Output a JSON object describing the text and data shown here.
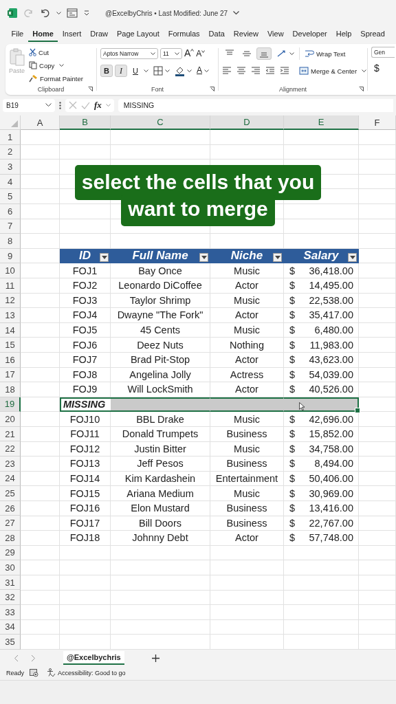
{
  "title_bar": {
    "title": "@ExcelbyChris • Last Modified: June 27"
  },
  "menu_tabs": [
    {
      "label": "File",
      "selected": false
    },
    {
      "label": "Home",
      "selected": true
    },
    {
      "label": "Insert",
      "selected": false
    },
    {
      "label": "Draw",
      "selected": false
    },
    {
      "label": "Page Layout",
      "selected": false
    },
    {
      "label": "Formulas",
      "selected": false
    },
    {
      "label": "Data",
      "selected": false
    },
    {
      "label": "Review",
      "selected": false
    },
    {
      "label": "View",
      "selected": false
    },
    {
      "label": "Developer",
      "selected": false
    },
    {
      "label": "Help",
      "selected": false
    },
    {
      "label": "Spread",
      "selected": false
    }
  ],
  "ribbon": {
    "clipboard": {
      "paste": "Paste",
      "paste_disabled": true,
      "cut": "Cut",
      "copy": "Copy",
      "format_painter": "Format Painter",
      "label": "Clipboard"
    },
    "font": {
      "font_name": "Aptos Narrow",
      "font_size": "11",
      "grow": "A",
      "shrink": "A",
      "bold": {
        "label": "B",
        "on": true
      },
      "italic": {
        "label": "I",
        "on": true
      },
      "underline": {
        "label": "U",
        "on": false
      },
      "font_color": "A",
      "label": "Font"
    },
    "alignment": {
      "vertical": [
        {
          "kind": "top",
          "selected": false
        },
        {
          "kind": "middle",
          "selected": false
        },
        {
          "kind": "bottom",
          "selected": true
        }
      ],
      "wrap_text": "Wrap Text",
      "merge": "Merge & Center",
      "label": "Alignment"
    },
    "number": {
      "format": "Gen",
      "currency": "$"
    }
  },
  "formula_bar": {
    "name_box": "B19",
    "function_label": "fx",
    "value": "MISSING"
  },
  "sheet": {
    "columns": [
      {
        "label": "A",
        "selected": false
      },
      {
        "label": "B",
        "selected": true
      },
      {
        "label": "C",
        "selected": true
      },
      {
        "label": "D",
        "selected": true
      },
      {
        "label": "E",
        "selected": true
      },
      {
        "label": "F",
        "selected": false
      }
    ],
    "header": [
      "ID",
      "Full Name",
      "Niche",
      "Salary"
    ],
    "rows": [
      {
        "number": "1",
        "kind": "empty",
        "selected": false
      },
      {
        "number": "2",
        "kind": "empty",
        "selected": false
      },
      {
        "number": "3",
        "kind": "empty",
        "selected": false
      },
      {
        "number": "4",
        "kind": "empty",
        "selected": false
      },
      {
        "number": "5",
        "kind": "empty",
        "selected": false
      },
      {
        "number": "6",
        "kind": "empty",
        "selected": false
      },
      {
        "number": "7",
        "kind": "empty",
        "selected": false
      },
      {
        "number": "8",
        "kind": "empty",
        "selected": false
      },
      {
        "number": "9",
        "kind": "header",
        "selected": false
      },
      {
        "number": "10",
        "kind": "data",
        "selected": false,
        "id": "FOJ1",
        "name": "Bay Once",
        "niche": "Music",
        "currency": "$",
        "salary": "36,418.00"
      },
      {
        "number": "11",
        "kind": "data",
        "selected": false,
        "id": "FOJ2",
        "name": "Leonardo DiCoffee",
        "niche": "Actor",
        "currency": "$",
        "salary": "14,495.00"
      },
      {
        "number": "12",
        "kind": "data",
        "selected": false,
        "id": "FOJ3",
        "name": "Taylor Shrimp",
        "niche": "Music",
        "currency": "$",
        "salary": "22,538.00"
      },
      {
        "number": "13",
        "kind": "data",
        "selected": false,
        "id": "FOJ4",
        "name": "Dwayne \"The Fork\"",
        "niche": "Actor",
        "currency": "$",
        "salary": "35,417.00"
      },
      {
        "number": "14",
        "kind": "data",
        "selected": false,
        "id": "FOJ5",
        "name": "45 Cents",
        "niche": "Music",
        "currency": "$",
        "salary": "6,480.00"
      },
      {
        "number": "15",
        "kind": "data",
        "selected": false,
        "id": "FOJ6",
        "name": "Deez Nuts",
        "niche": "Nothing",
        "currency": "$",
        "salary": "11,983.00"
      },
      {
        "number": "16",
        "kind": "data",
        "selected": false,
        "id": "FOJ7",
        "name": "Brad Pit-Stop",
        "niche": "Actor",
        "currency": "$",
        "salary": "43,623.00"
      },
      {
        "number": "17",
        "kind": "data",
        "selected": false,
        "id": "FOJ8",
        "name": "Angelina Jolly",
        "niche": "Actress",
        "currency": "$",
        "salary": "54,039.00"
      },
      {
        "number": "18",
        "kind": "data",
        "selected": false,
        "id": "FOJ9",
        "name": "Will LockSmith",
        "niche": "Actor",
        "currency": "$",
        "salary": "40,526.00"
      },
      {
        "number": "19",
        "kind": "note",
        "selected": true,
        "text": "MISSING"
      },
      {
        "number": "20",
        "kind": "data",
        "selected": false,
        "id": "FOJ10",
        "name": "BBL Drake",
        "niche": "Music",
        "currency": "$",
        "salary": "42,696.00"
      },
      {
        "number": "21",
        "kind": "data",
        "selected": false,
        "id": "FOJ11",
        "name": "Donald Trumpets",
        "niche": "Business",
        "currency": "$",
        "salary": "15,852.00"
      },
      {
        "number": "22",
        "kind": "data",
        "selected": false,
        "id": "FOJ12",
        "name": "Justin Bitter",
        "niche": "Music",
        "currency": "$",
        "salary": "34,758.00"
      },
      {
        "number": "23",
        "kind": "data",
        "selected": false,
        "id": "FOJ13",
        "name": "Jeff Pesos",
        "niche": "Business",
        "currency": "$",
        "salary": "8,494.00"
      },
      {
        "number": "24",
        "kind": "data",
        "selected": false,
        "id": "FOJ14",
        "name": "Kim Kardashein",
        "niche": "Entertainment",
        "currency": "$",
        "salary": "50,406.00"
      },
      {
        "number": "25",
        "kind": "data",
        "selected": false,
        "id": "FOJ15",
        "name": "Ariana Medium",
        "niche": "Music",
        "currency": "$",
        "salary": "30,969.00"
      },
      {
        "number": "26",
        "kind": "data",
        "selected": false,
        "id": "FOJ16",
        "name": "Elon Mustard",
        "niche": "Business",
        "currency": "$",
        "salary": "13,416.00"
      },
      {
        "number": "27",
        "kind": "data",
        "selected": false,
        "id": "FOJ17",
        "name": "Bill Doors",
        "niche": "Business",
        "currency": "$",
        "salary": "22,767.00"
      },
      {
        "number": "28",
        "kind": "data",
        "selected": false,
        "id": "FOJ18",
        "name": "Johnny Debt",
        "niche": "Actor",
        "currency": "$",
        "salary": "57,748.00"
      },
      {
        "number": "29",
        "kind": "empty",
        "selected": false
      },
      {
        "number": "30",
        "kind": "empty",
        "selected": false
      },
      {
        "number": "31",
        "kind": "empty",
        "selected": false
      },
      {
        "number": "32",
        "kind": "empty",
        "selected": false
      },
      {
        "number": "33",
        "kind": "empty",
        "selected": false
      },
      {
        "number": "34",
        "kind": "empty",
        "selected": false
      },
      {
        "number": "35",
        "kind": "empty",
        "selected": false
      }
    ]
  },
  "caption": [
    "select the cells that you",
    "want to merge"
  ],
  "sheet_tabs": [
    {
      "label": "@Excelbychris",
      "selected": true
    }
  ],
  "status_bar": {
    "ready": "Ready",
    "accessibility": "Accessibility: Good to go"
  }
}
